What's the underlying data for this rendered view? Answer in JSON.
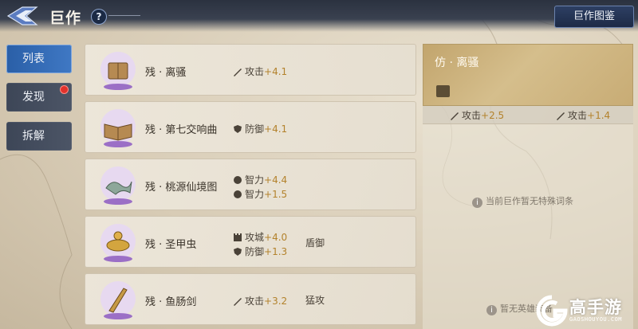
{
  "header": {
    "title": "巨作",
    "help_symbol": "?",
    "catalog_button": "巨作图鉴"
  },
  "tabs": [
    {
      "label": "列表",
      "active": true
    },
    {
      "label": "发现",
      "active": false,
      "has_notification": true
    },
    {
      "label": "拆解",
      "active": false
    }
  ],
  "items": [
    {
      "name": "残 · 离骚",
      "icon": "scroll-book-icon",
      "stats": [
        {
          "icon": "sword-icon",
          "label": "攻击",
          "value": "+4.1"
        }
      ],
      "tag": ""
    },
    {
      "name": "残 · 第七交响曲",
      "icon": "open-book-icon",
      "stats": [
        {
          "icon": "shield-icon",
          "label": "防御",
          "value": "+4.1"
        }
      ],
      "tag": ""
    },
    {
      "name": "残 · 桃源仙境图",
      "icon": "painting-icon",
      "stats": [
        {
          "icon": "brain-icon",
          "label": "智力",
          "value": "+4.4"
        },
        {
          "icon": "brain-icon",
          "label": "智力",
          "value": "+1.5"
        }
      ],
      "tag": ""
    },
    {
      "name": "残 · 圣甲虫",
      "icon": "scarab-icon",
      "stats": [
        {
          "icon": "tower-icon",
          "label": "攻城",
          "value": "+4.0"
        },
        {
          "icon": "shield-icon",
          "label": "防御",
          "value": "+1.3"
        }
      ],
      "tag": "盾御"
    },
    {
      "name": "残 · 鱼肠剑",
      "icon": "dagger-icon",
      "stats": [
        {
          "icon": "sword-icon",
          "label": "攻击",
          "value": "+3.2"
        }
      ],
      "tag": "猛攻"
    }
  ],
  "detail": {
    "title": "仿 · 离骚",
    "stats": [
      {
        "icon": "sword-icon",
        "label": "攻击",
        "value": "+2.5"
      },
      {
        "icon": "sword-icon",
        "label": "攻击",
        "value": "+1.4"
      }
    ],
    "no_special": "当前巨作暂无特殊词条",
    "equip_hint": "暂无英雄装备"
  },
  "watermark": {
    "text": "高手游",
    "sub": "GAOSHOUYOU.COM"
  },
  "colors": {
    "accent_gold": "#b3822c",
    "tab_active": "#3f78c4",
    "badge_red": "#e2322c"
  }
}
